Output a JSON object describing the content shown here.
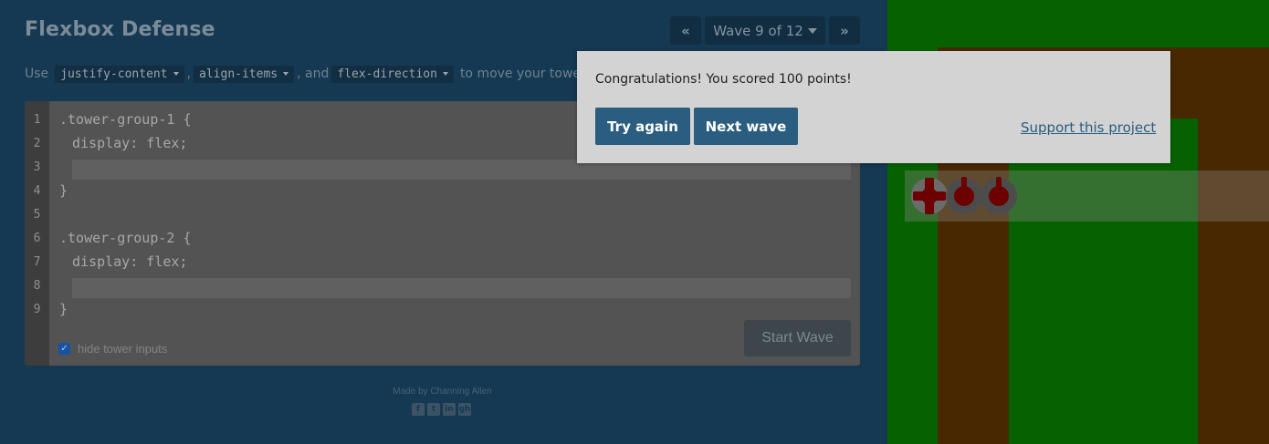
{
  "header": {
    "title": "Flexbox Defense",
    "wave_prev": "«",
    "wave_label": "Wave 9 of 12",
    "wave_next": "»"
  },
  "instructions": {
    "prefix": "Use",
    "prop1": "justify-content",
    "sep1": ",",
    "prop2": "align-items",
    "sep2": ", and",
    "prop3": "flex-direction",
    "suffix": "to move your towers into p"
  },
  "editor": {
    "line_numbers": [
      "1",
      "2",
      "3",
      "4",
      "5",
      "6",
      "7",
      "8",
      "9"
    ],
    "lines": {
      "l1": ".tower-group-1 {",
      "l2": "display: flex;",
      "l4": "}",
      "l6": ".tower-group-2 {",
      "l7": "display: flex;",
      "l9": "}"
    },
    "hide_inputs_label": "hide tower inputs",
    "hide_inputs_checked": true,
    "start_label": "Start Wave"
  },
  "footer": {
    "credit": "Made by Channing Allen",
    "icons": [
      "facebook-icon",
      "twitter-icon",
      "linkedin-icon",
      "github-icon"
    ],
    "icon_glyphs": [
      "f",
      "t",
      "in",
      "gh"
    ]
  },
  "modal": {
    "message": "Congratulations! You scored 100 points!",
    "try_again": "Try again",
    "next_wave": "Next wave",
    "support": "Support this project"
  },
  "colors": {
    "background": "#1c4a6a",
    "grass": "#087d00",
    "path": "#5c3401",
    "button": "#2a5d7f",
    "tower": "#8c0000"
  }
}
